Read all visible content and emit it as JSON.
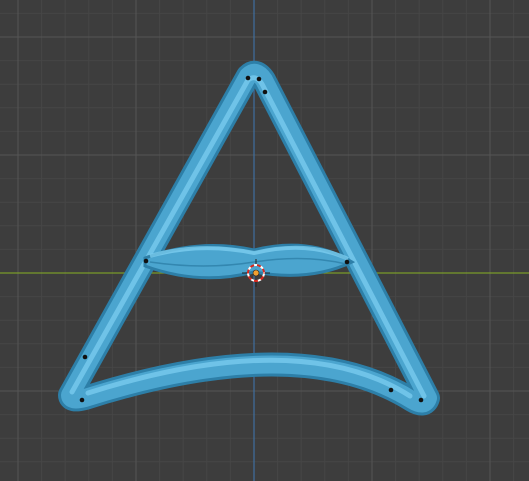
{
  "viewport": {
    "background": "#3d3d3d",
    "grid_minor_color": "#464646",
    "grid_major_color": "#555555",
    "x_axis_color": "#7a9a2a",
    "y_axis_color": "#3f6f9f"
  },
  "object": {
    "shape": "curved-triangle-tube",
    "color": "#4ba5cf",
    "highlight_color": "#7fd0f2",
    "shadow_color": "#2d7fa8",
    "vertex_color": "#111111"
  },
  "cursor": {
    "icon": "3d-cursor-icon",
    "ring_colors": [
      "#ffffff",
      "#d9281e"
    ]
  },
  "origin": {
    "icon": "origin-point-icon",
    "color": "#f0a030"
  }
}
